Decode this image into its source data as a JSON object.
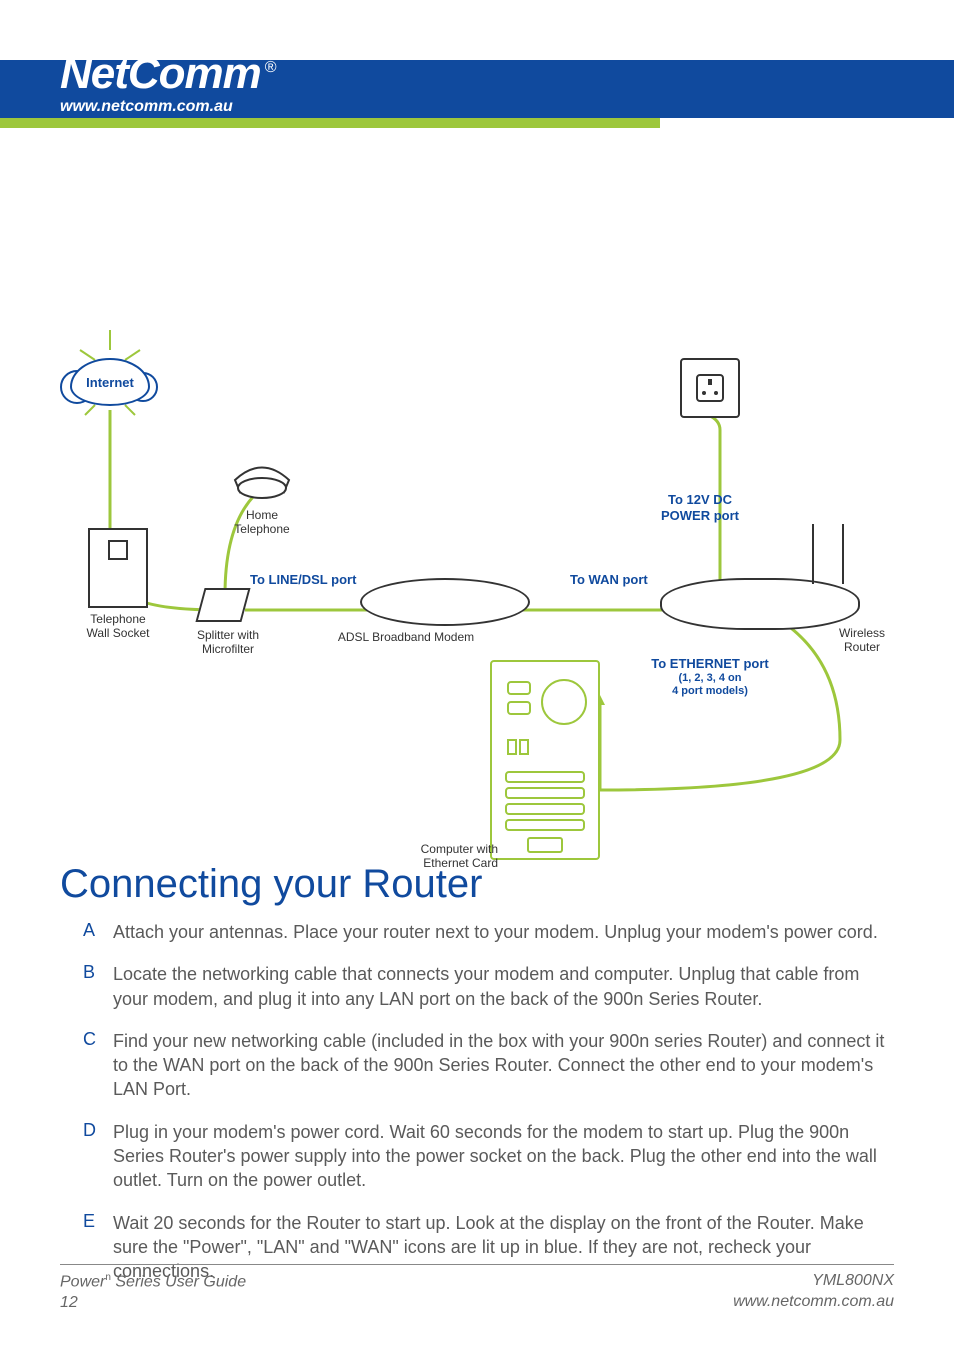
{
  "header": {
    "brand": "NetComm",
    "reg": "®",
    "url": "www.netcomm.com.au"
  },
  "diagram": {
    "internet": "Internet",
    "home_telephone": "Home\nTelephone",
    "telephone_wall_socket": "Telephone\nWall Socket",
    "splitter": "Splitter with\nMicrofilter",
    "adsl_modem": "ADSL Broadband Modem",
    "to_line_dsl": "To LINE/DSL port",
    "to_wan": "To WAN port",
    "to_power": "To 12V DC\nPOWER port",
    "to_ethernet": "To ETHERNET port",
    "to_ethernet_sub": "(1, 2, 3, 4 on\n4 port models)",
    "wireless_router": "Wireless\nRouter",
    "computer": "Computer with\nEthernet Card"
  },
  "title": "Connecting your Router",
  "steps": [
    {
      "letter": "A",
      "text": "Attach your antennas. Place your router next to your modem. Unplug your modem's power cord."
    },
    {
      "letter": "B",
      "text": "Locate the networking cable that connects your modem and computer. Unplug that cable from your modem, and plug it into any LAN port on the back of the 900n Series Router."
    },
    {
      "letter": "C",
      "text": "Find your new networking cable (included in the box with your 900n series Router) and connect it to the WAN port on the back of the 900n Series Router. Connect the other end to your modem's LAN Port."
    },
    {
      "letter": "D",
      "text": "Plug in your modem's power cord. Wait 60 seconds for the modem to start up. Plug the 900n Series Router's power supply into the power socket on the back. Plug the other end into the wall outlet. Turn on the power outlet."
    },
    {
      "letter": "E",
      "text": "Wait 20 seconds for the Router to start up. Look at the display on the front of the Router. Make sure the \"Power\", \"LAN\" and \"WAN\" icons are lit up in blue. If they are not, recheck your connections."
    }
  ],
  "footer": {
    "guide": "Power",
    "guide_sup": "n",
    "guide_rest": " Series User Guide",
    "page": "12",
    "model": "YML800NX",
    "url": "www.netcomm.com.au"
  }
}
